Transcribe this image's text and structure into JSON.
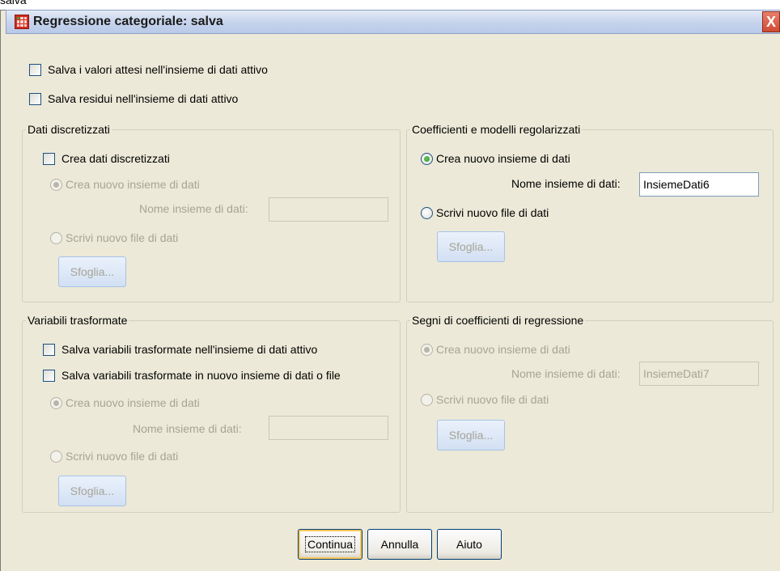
{
  "above_label": "salva",
  "window": {
    "title": "Regressione categoriale: salva",
    "close_glyph": "X"
  },
  "top_options": {
    "save_predicted": "Salva i valori attesi nell'insieme di dati attivo",
    "save_residuals": "Salva residui nell'insieme di dati attivo"
  },
  "discretized": {
    "group_title": "Dati discretizzati",
    "create_label": "Crea dati discretizzati",
    "radio_new_dataset": "Crea nuovo insieme di dati",
    "dataset_name_label": "Nome insieme di dati:",
    "dataset_name_value": "",
    "radio_write_file": "Scrivi nuovo file di dati",
    "browse_label": "Sfoglia..."
  },
  "regularized": {
    "group_title": "Coefficienti e modelli regolarizzati",
    "radio_new_dataset": "Crea nuovo insieme di dati",
    "dataset_name_label": "Nome insieme di dati:",
    "dataset_name_value": "InsiemeDati6",
    "radio_write_file": "Scrivi nuovo file di dati",
    "browse_label": "Sfoglia..."
  },
  "transformed": {
    "group_title": "Variabili trasformate",
    "save_active": "Salva variabili trasformate nell'insieme di dati attivo",
    "save_new": "Salva variabili trasformate in nuovo insieme di dati o file",
    "radio_new_dataset": "Crea nuovo insieme di dati",
    "dataset_name_label": "Nome insieme di dati:",
    "dataset_name_value": "",
    "radio_write_file": "Scrivi nuovo file di dati",
    "browse_label": "Sfoglia..."
  },
  "signs": {
    "group_title": "Segni di coefficienti di regressione",
    "radio_new_dataset": "Crea nuovo insieme di dati",
    "dataset_name_label": "Nome insieme di dati:",
    "dataset_name_value": "InsiemeDati7",
    "radio_write_file": "Scrivi nuovo file di dati",
    "browse_label": "Sfoglia..."
  },
  "buttons": {
    "continue": "Continua",
    "cancel": "Annulla",
    "help": "Aiuto"
  },
  "icons": {
    "app": "spss-grid-icon",
    "close": "close-icon"
  },
  "colors": {
    "dialog_bg": "#ece9d8",
    "title_gradient_top": "#e3eaf7",
    "close_red": "#cf4a33",
    "disabled_text": "#a6a497"
  }
}
